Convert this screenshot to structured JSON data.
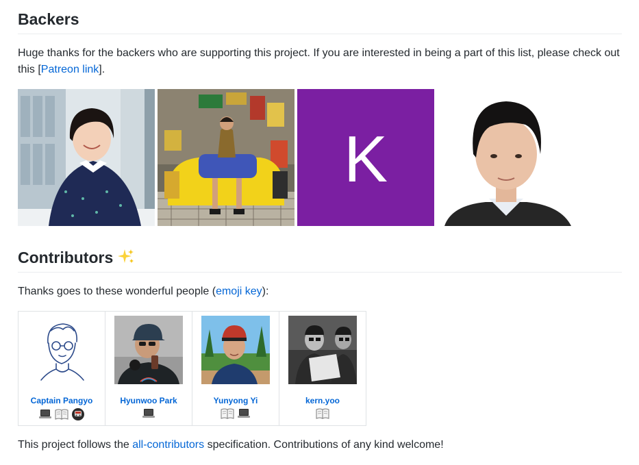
{
  "backers": {
    "heading": "Backers",
    "text_before": "Huge thanks for the backers who are supporting this project. If you are interested in being a part of this list, please check out this [",
    "link_text": "Patreon link",
    "text_after": "].",
    "letter_avatar": "K",
    "letter_avatar_color": "#7b1fa2"
  },
  "contributors": {
    "heading": "Contributors",
    "text_before": "Thanks goes to these wonderful people (",
    "link_text": "emoji key",
    "text_after": "):",
    "people": [
      {
        "name": "Captain Pangyo",
        "contributions": [
          "code",
          "doc",
          "infra"
        ]
      },
      {
        "name": "Hyunwoo Park",
        "contributions": [
          "code"
        ]
      },
      {
        "name": "Yunyong Yi",
        "contributions": [
          "doc",
          "code"
        ]
      },
      {
        "name": "kern.yoo",
        "contributions": [
          "doc"
        ]
      }
    ]
  },
  "footer": {
    "text_before": "This project follows the ",
    "link_text": "all-contributors",
    "text_after": " specification. Contributions of any kind welcome!"
  },
  "colors": {
    "link": "#0366d6",
    "text": "#24292e",
    "border": "#dfe2e5"
  }
}
